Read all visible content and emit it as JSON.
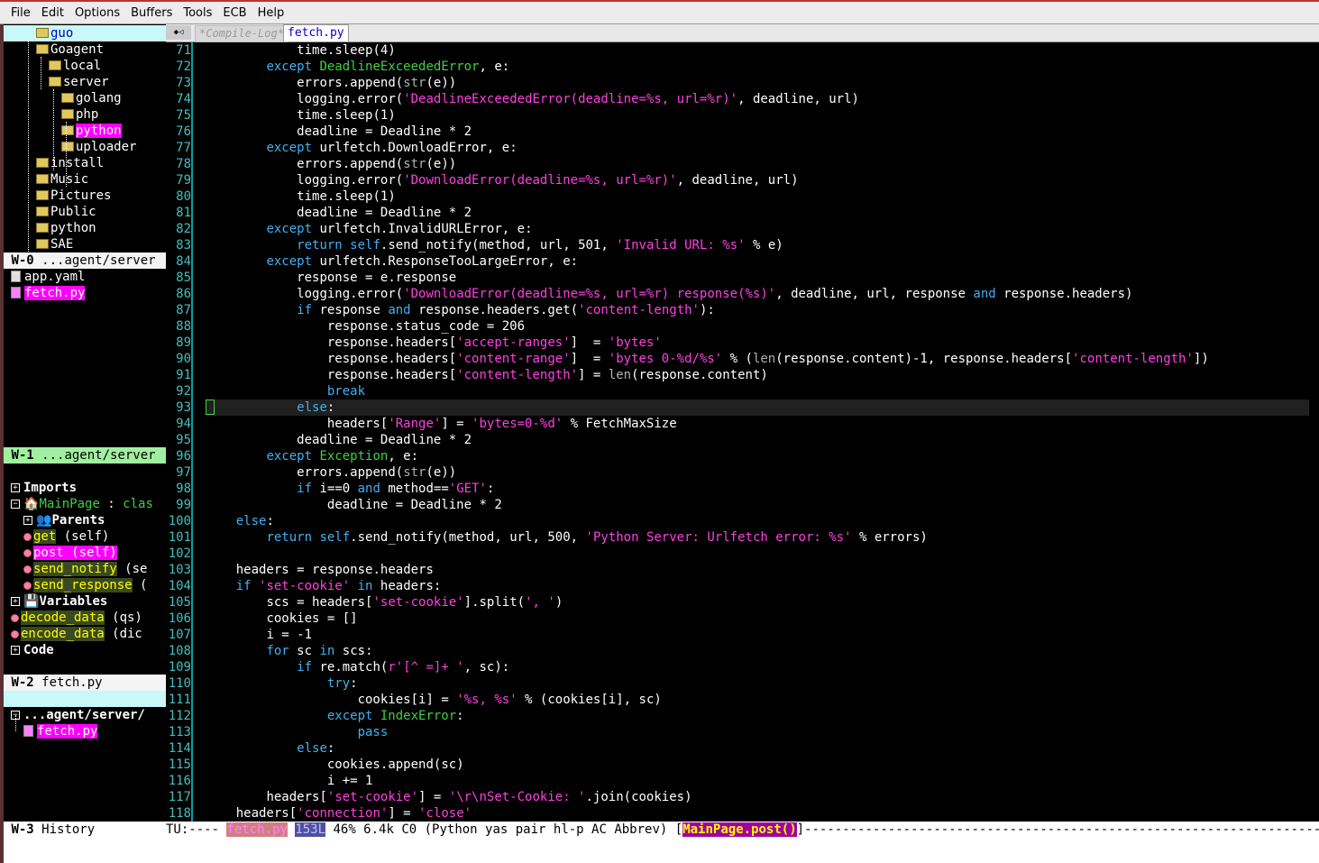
{
  "menu": [
    "File",
    "Edit",
    "Options",
    "Buffers",
    "Tools",
    "ECB",
    "Help"
  ],
  "tabs": {
    "arrows": "◆◁",
    "compile_log": "*Compile-Log*",
    "fetch": "fetch.py"
  },
  "dir_tree": [
    {
      "label": "guo",
      "depth": 0,
      "selected_cyan": true
    },
    {
      "label": "Goagent",
      "depth": 1
    },
    {
      "label": "local",
      "depth": 2
    },
    {
      "label": "server",
      "depth": 2
    },
    {
      "label": "golang",
      "depth": 3
    },
    {
      "label": "php",
      "depth": 3
    },
    {
      "label": "python",
      "depth": 3,
      "highlight": true
    },
    {
      "label": "uploader",
      "depth": 3
    },
    {
      "label": "install",
      "depth": 1
    },
    {
      "label": "Music",
      "depth": 1
    },
    {
      "label": "Pictures",
      "depth": 1
    },
    {
      "label": "Public",
      "depth": 1
    },
    {
      "label": "python",
      "depth": 1
    },
    {
      "label": "SAE",
      "depth": 1
    }
  ],
  "w0": {
    "id": "W-0",
    "path": "...agent/server"
  },
  "files": [
    {
      "label": "app.yaml",
      "highlight": false
    },
    {
      "label": "fetch.py",
      "highlight": true
    }
  ],
  "w1": {
    "id": "W-1",
    "path": "...agent/server"
  },
  "methods": {
    "imports": "Imports",
    "class_name": "MainPage",
    "class_sep": " : ",
    "class_kind": "clas",
    "parents": "Parents",
    "items": [
      {
        "name": "get",
        "args": " (self)",
        "style": "y"
      },
      {
        "name": "post (self)",
        "args": "",
        "style": "m"
      },
      {
        "name": "send_notify",
        "args": " (se",
        "style": "y"
      },
      {
        "name": "send_response",
        "args": " (",
        "style": "y"
      }
    ],
    "variables": "Variables",
    "vars": [
      {
        "name": "decode_data",
        "args": " (qs)"
      },
      {
        "name": "encode_data",
        "args": " (dic"
      }
    ],
    "code": "Code"
  },
  "w2": {
    "id": "W-2",
    "path": "fetch.py"
  },
  "history": {
    "dir": "...agent/server/",
    "file": "fetch.py"
  },
  "w3": {
    "id": "W-3",
    "path": "History"
  },
  "code_lines": [
    {
      "n": "71",
      "text": "            time.sleep(4)"
    },
    {
      "n": "72",
      "text": "        except DeadlineExceededError, e:"
    },
    {
      "n": "73",
      "text": "            errors.append(str(e))"
    },
    {
      "n": "74",
      "text": "            logging.error('DeadlineExceededError(deadline=%s, url=%r)', deadline, url)"
    },
    {
      "n": "75",
      "text": "            time.sleep(1)"
    },
    {
      "n": "76",
      "text": "            deadline = Deadline * 2"
    },
    {
      "n": "77",
      "text": "        except urlfetch.DownloadError, e:"
    },
    {
      "n": "78",
      "text": "            errors.append(str(e))"
    },
    {
      "n": "79",
      "text": "            logging.error('DownloadError(deadline=%s, url=%r)', deadline, url)"
    },
    {
      "n": "80",
      "text": "            time.sleep(1)"
    },
    {
      "n": "81",
      "text": "            deadline = Deadline * 2"
    },
    {
      "n": "82",
      "text": "        except urlfetch.InvalidURLError, e:"
    },
    {
      "n": "83",
      "text": "            return self.send_notify(method, url, 501, 'Invalid URL: %s' % e)"
    },
    {
      "n": "84",
      "text": "        except urlfetch.ResponseTooLargeError, e:"
    },
    {
      "n": "85",
      "text": "            response = e.response"
    },
    {
      "n": "86",
      "text": "            logging.error('DownloadError(deadline=%s, url=%r) response(%s)', deadline, url, response and response.headers)"
    },
    {
      "n": "87",
      "text": "            if response and response.headers.get('content-length'):"
    },
    {
      "n": "88",
      "text": "                response.status_code = 206"
    },
    {
      "n": "89",
      "text": "                response.headers['accept-ranges']  = 'bytes'"
    },
    {
      "n": "90",
      "text": "                response.headers['content-range']  = 'bytes 0-%d/%s' % (len(response.content)-1, response.headers['content-length'])"
    },
    {
      "n": "91",
      "text": "                response.headers['content-length'] = len(response.content)"
    },
    {
      "n": "92",
      "text": "                break"
    },
    {
      "n": "93",
      "text": "            else:"
    },
    {
      "n": "94",
      "text": "                headers['Range'] = 'bytes=0-%d' % FetchMaxSize"
    },
    {
      "n": "95",
      "text": "            deadline = Deadline * 2"
    },
    {
      "n": "96",
      "text": "        except Exception, e:"
    },
    {
      "n": "97",
      "text": "            errors.append(str(e))"
    },
    {
      "n": "98",
      "text": "            if i==0 and method=='GET':"
    },
    {
      "n": "99",
      "text": "                deadline = Deadline * 2"
    },
    {
      "n": "100",
      "text": "    else:"
    },
    {
      "n": "101",
      "text": "        return self.send_notify(method, url, 500, 'Python Server: Urlfetch error: %s' % errors)"
    },
    {
      "n": "102",
      "text": ""
    },
    {
      "n": "103",
      "text": "    headers = response.headers"
    },
    {
      "n": "104",
      "text": "    if 'set-cookie' in headers:"
    },
    {
      "n": "105",
      "text": "        scs = headers['set-cookie'].split(', ')"
    },
    {
      "n": "106",
      "text": "        cookies = []"
    },
    {
      "n": "107",
      "text": "        i = -1"
    },
    {
      "n": "108",
      "text": "        for sc in scs:"
    },
    {
      "n": "109",
      "text": "            if re.match(r'[^ =]+ ', sc):"
    },
    {
      "n": "110",
      "text": "                try:"
    },
    {
      "n": "111",
      "text": "                    cookies[i] = '%s, %s' % (cookies[i], sc)"
    },
    {
      "n": "112",
      "text": "                except IndexError:"
    },
    {
      "n": "113",
      "text": "                    pass"
    },
    {
      "n": "114",
      "text": "            else:"
    },
    {
      "n": "115",
      "text": "                cookies.append(sc)"
    },
    {
      "n": "116",
      "text": "                i += 1"
    },
    {
      "n": "117",
      "text": "        headers['set-cookie'] = '\\r\\nSet-Cookie: '.join(cookies)"
    },
    {
      "n": "118",
      "text": "    headers['connection'] = 'close'"
    }
  ],
  "current_line": "93",
  "modeline": {
    "status": "TU:---- ",
    "file": "fetch.py",
    "lines": "153L",
    "info": " 46% 6.4k C0 (Python yas pair hl-p AC Abbrev) [",
    "func": "MainPage.post()",
    "tail": "]--------------------------------------------------------------------------"
  },
  "colors": {
    "keyword": "#40b0f0",
    "string": "#ff40e0",
    "builtin_class": "#40d040",
    "line_number": "#40c0c0",
    "highlight": "#ff00ff"
  }
}
